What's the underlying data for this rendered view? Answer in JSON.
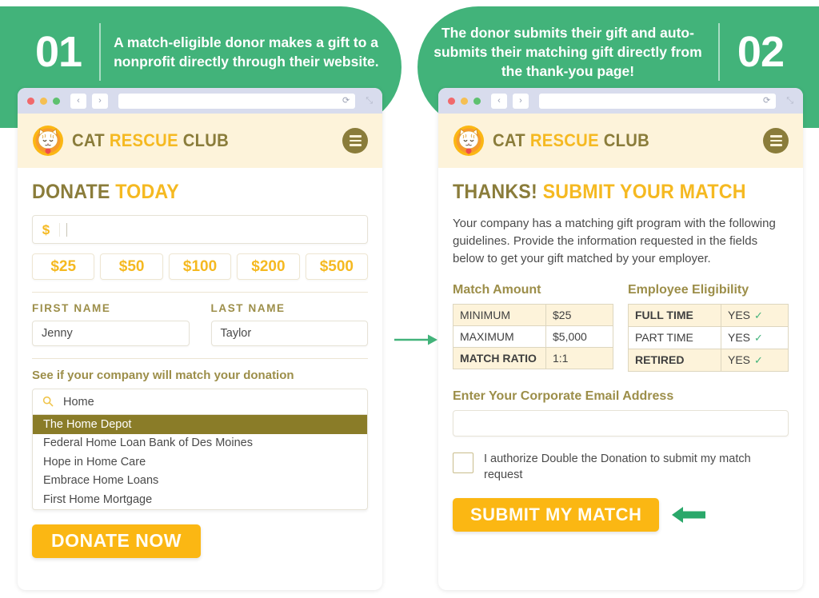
{
  "steps": [
    {
      "number": "01",
      "text": "A match-eligible donor makes a gift to a nonprofit directly through their website."
    },
    {
      "number": "02",
      "text": "The donor submits their gift and auto-submits their matching gift directly from the thank-you page!"
    }
  ],
  "colors": {
    "green": "#42b37a",
    "yellow": "#fbb713",
    "olive": "#8a7c3a",
    "cream": "#fdf3da",
    "dropdown_selected": "#8a7c28"
  },
  "browser_chrome": {
    "back_icon": "‹",
    "forward_icon": "›",
    "reload_icon": "⟳",
    "expand_icon": "⤡",
    "url": ""
  },
  "site_header": {
    "logo_icon": "cat-logo-icon",
    "brand_part1": "CAT ",
    "brand_part2": "RESCUE ",
    "brand_part3": "CLUB",
    "menu_icon": "hamburger-menu-icon"
  },
  "donate_page": {
    "title_part1": "DONATE ",
    "title_part2": "TODAY",
    "currency_symbol": "$",
    "amount_value": "",
    "amount_placeholder": "",
    "amount_options": [
      "$25",
      "$50",
      "$100",
      "$200",
      "$500"
    ],
    "first_name_label": "FIRST NAME",
    "first_name_value": "Jenny",
    "last_name_label": "LAST NAME",
    "last_name_value": "Taylor",
    "match_prompt": "See if your company will match your donation",
    "search_icon": "search-icon",
    "search_value": "Home",
    "dropdown_options": [
      {
        "label": "The Home Depot",
        "selected": true
      },
      {
        "label": "Federal Home Loan Bank of Des Moines",
        "selected": false
      },
      {
        "label": "Hope in Home Care",
        "selected": false
      },
      {
        "label": "Embrace Home Loans",
        "selected": false
      },
      {
        "label": "First Home Mortgage",
        "selected": false
      }
    ],
    "donate_button": "DONATE NOW"
  },
  "match_page": {
    "title_part1": "THANKS! ",
    "title_part2": "SUBMIT YOUR MATCH",
    "body": "Your company has a matching gift program with the following guidelines. Provide the information requested in the fields below to get your gift matched by your employer.",
    "match_amount": {
      "heading": "Match Amount",
      "rows": [
        {
          "key": "MINIMUM",
          "value": "$25",
          "bold": false
        },
        {
          "key": "MAXIMUM",
          "value": "$5,000",
          "bold": false
        },
        {
          "key": "MATCH RATIO",
          "value": "1:1",
          "bold": true
        }
      ]
    },
    "employee_eligibility": {
      "heading": "Employee Eligibility",
      "check_icon": "✓",
      "rows": [
        {
          "key": "FULL TIME",
          "value": "YES",
          "bold": true
        },
        {
          "key": "PART TIME",
          "value": "YES",
          "bold": false
        },
        {
          "key": "RETIRED",
          "value": "YES",
          "bold": true
        }
      ]
    },
    "email_label": "Enter Your Corporate Email Address",
    "email_value": "",
    "email_placeholder": "",
    "authorize_text": "I authorize Double the Donation to submit my match request",
    "authorize_checked": false,
    "submit_button": "SUBMIT MY MATCH",
    "arrow_icon": "arrow-left-icon"
  },
  "flow_arrow": {
    "icon": "arrow-right-icon"
  }
}
